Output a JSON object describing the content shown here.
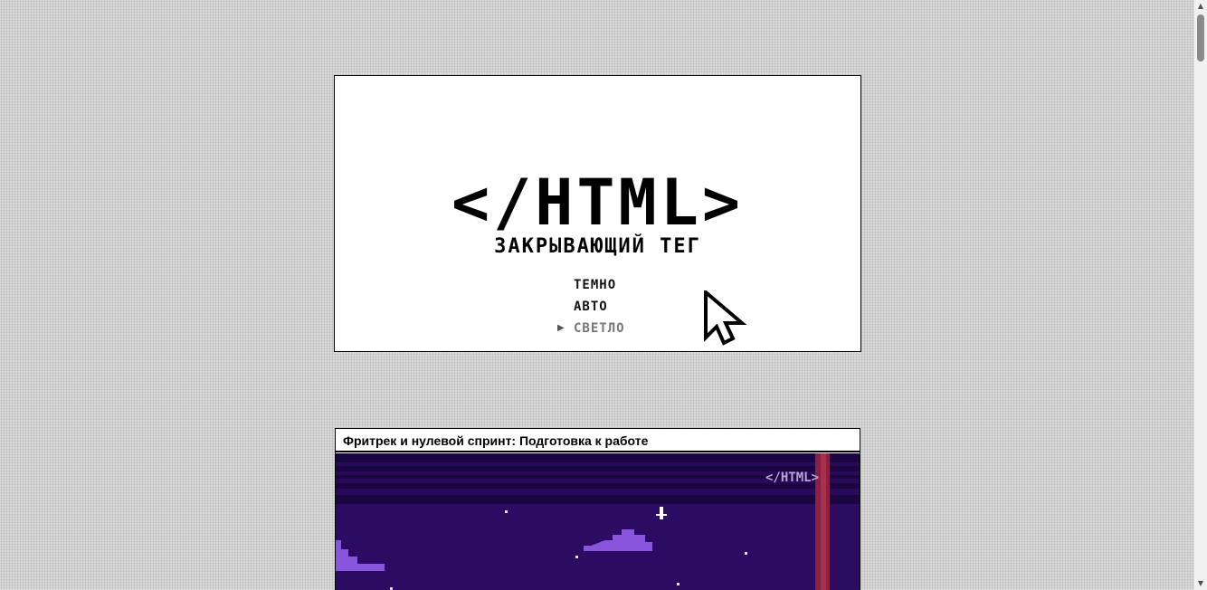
{
  "hero": {
    "logo": "</HTML>",
    "subtitle": "ЗАКРЫВАЮЩИЙ ТЕГ",
    "theme_options": [
      "ТЕМНО",
      "АВТО",
      "СВЕТЛО"
    ],
    "selected_theme": "СВЕТЛО",
    "marker_icon": "triangle-right"
  },
  "video": {
    "title": "Фритрек и нулевой спринт: Подготовка к работе",
    "thumbnail_watermark": "</HTML>"
  },
  "colors": {
    "page_background": "#d9d9d9",
    "thumbnail_background": "#290a5a",
    "thumbnail_accent": "#8a55dd",
    "thumbnail_beam": "#8a2142"
  }
}
